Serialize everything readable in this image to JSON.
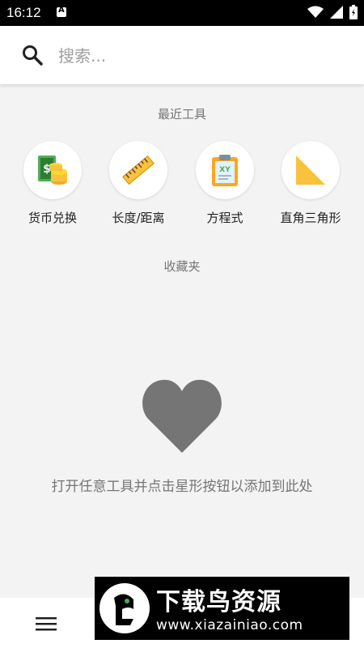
{
  "status_bar": {
    "time": "16:12"
  },
  "search": {
    "placeholder": "搜索..."
  },
  "recent": {
    "title": "最近工具",
    "tools": [
      {
        "label": "货币兑换",
        "icon": "currency-exchange-icon"
      },
      {
        "label": "长度/距离",
        "icon": "ruler-icon"
      },
      {
        "label": "方程式",
        "icon": "clipboard-equation-icon"
      },
      {
        "label": "直角三角形",
        "icon": "right-triangle-icon"
      }
    ]
  },
  "favorites": {
    "title": "收藏夹",
    "hint": "打开任意工具并点击星形按钮以添加到此处",
    "icon": "heart-icon"
  },
  "watermark": {
    "title": "下载鸟资源",
    "url": "www.xiazainiao.com"
  },
  "colors": {
    "accent_yellow": "#f9c23c",
    "heart_gray": "#757575",
    "background": "#f3f3f3"
  }
}
